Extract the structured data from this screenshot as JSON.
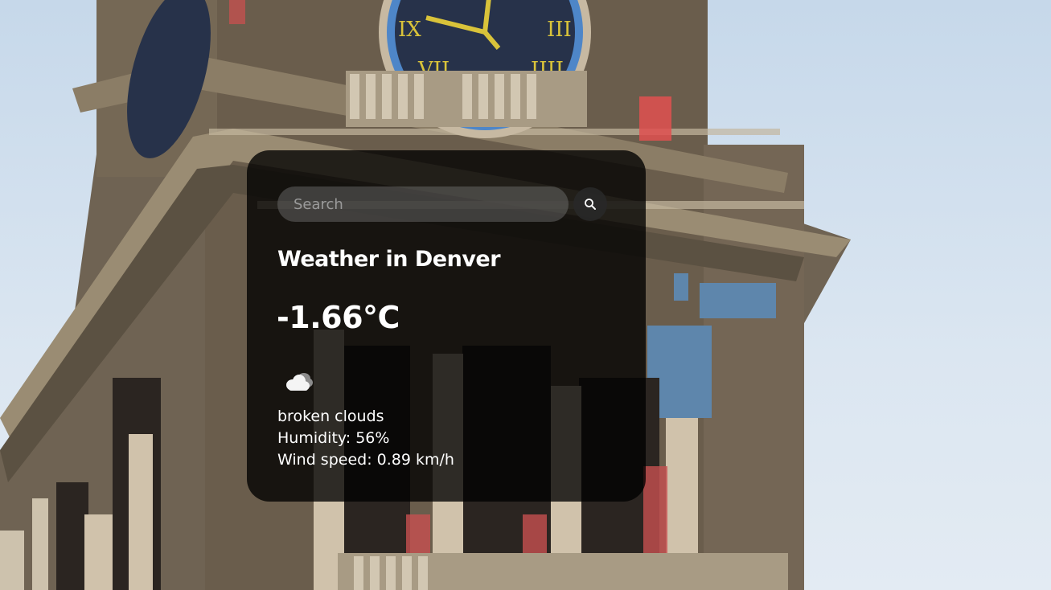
{
  "search": {
    "placeholder": "Search",
    "value": ""
  },
  "weather": {
    "title": "Weather in Denver",
    "temperature": "-1.66°C",
    "icon": "broken-clouds-icon",
    "description": "broken clouds",
    "humidity": "Humidity: 56%",
    "wind": "Wind speed: 0.89 km/h"
  },
  "colors": {
    "card_background": "#000000c7",
    "text": "#ffffff",
    "sky": "#d3e1ee",
    "brick": "#6b5e4c",
    "clock_face": "#27324a",
    "clock_ring": "#4e86c8",
    "clock_numerals": "#d9c33a"
  }
}
